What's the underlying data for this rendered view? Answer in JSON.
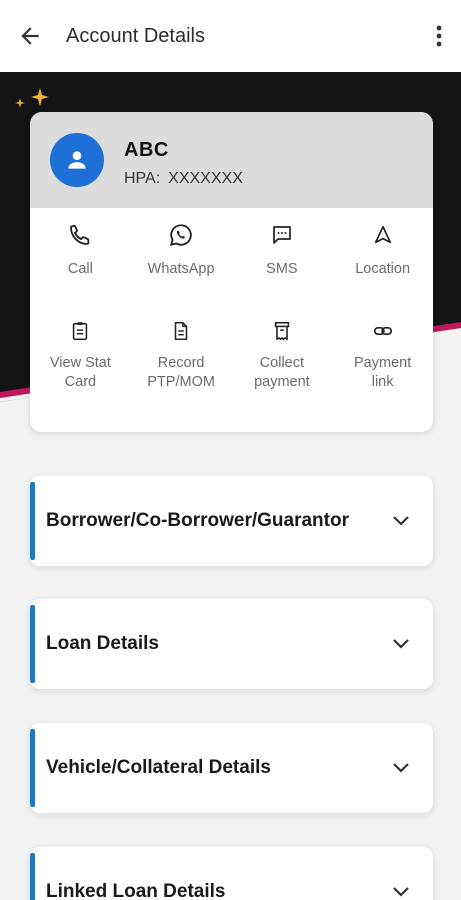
{
  "header": {
    "title": "Account Details"
  },
  "profile": {
    "name": "ABC",
    "hpa_label": "HPA:",
    "hpa_value": "XXXXXXX"
  },
  "actions": [
    {
      "label": "Call",
      "icon": "phone-icon"
    },
    {
      "label": "WhatsApp",
      "icon": "whatsapp-icon"
    },
    {
      "label": "SMS",
      "icon": "sms-icon"
    },
    {
      "label": "Location",
      "icon": "location-icon"
    },
    {
      "label": "View Stat Card",
      "icon": "clipboard-icon"
    },
    {
      "label": "Record PTP/MOM",
      "icon": "document-icon"
    },
    {
      "label": "Collect payment",
      "icon": "receipt-icon"
    },
    {
      "label": "Payment link",
      "icon": "link-icon"
    }
  ],
  "sections": [
    {
      "title": "Borrower/Co-Borrower/Guarantor"
    },
    {
      "title": "Loan Details"
    },
    {
      "title": "Vehicle/Collateral Details"
    },
    {
      "title": "Linked Loan Details"
    }
  ],
  "colors": {
    "accent": "#1f78c1",
    "avatar": "#1e6fd6",
    "hero_dark": "#141414",
    "hero_stripe": "#c2185b"
  }
}
